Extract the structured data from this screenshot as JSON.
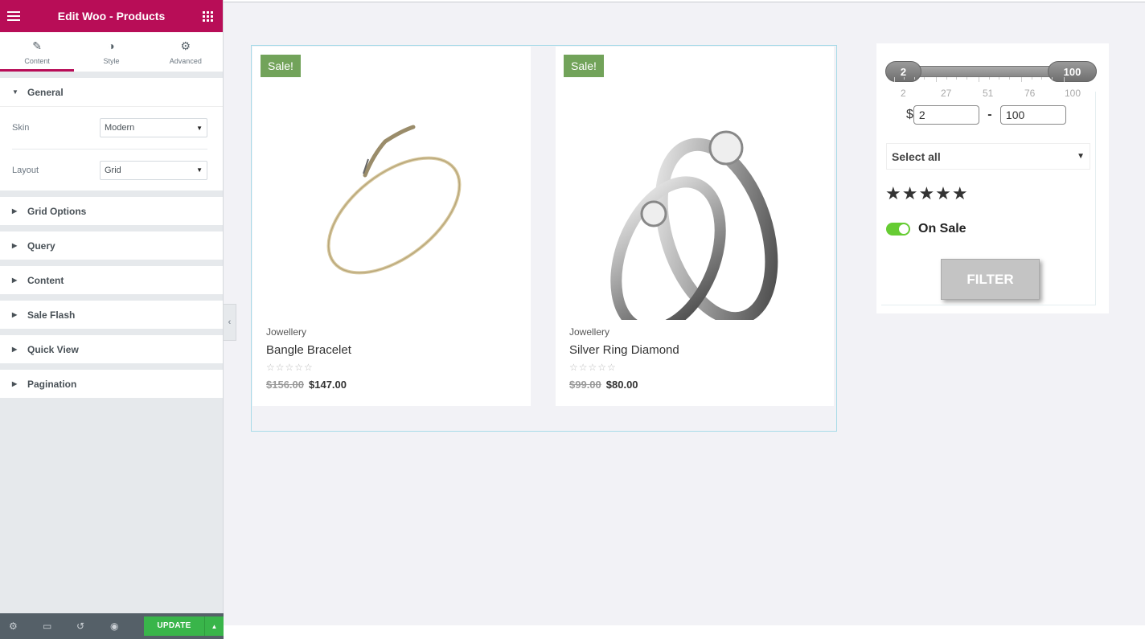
{
  "panel": {
    "title": "Edit Woo - Products",
    "tabs": [
      {
        "label": "Content",
        "icon": "pencil-icon"
      },
      {
        "label": "Style",
        "icon": "half-circle-icon"
      },
      {
        "label": "Advanced",
        "icon": "gear-icon"
      }
    ],
    "general": {
      "heading": "General",
      "skin_label": "Skin",
      "skin_value": "Modern",
      "layout_label": "Layout",
      "layout_value": "Grid"
    },
    "sections": [
      "Grid Options",
      "Query",
      "Content",
      "Sale Flash",
      "Quick View",
      "Pagination"
    ],
    "footer": {
      "update_label": "UPDATE"
    }
  },
  "products": [
    {
      "badge": "Sale!",
      "category": "Jowellery",
      "name": "Bangle Bracelet",
      "old_price": "$156.00",
      "price": "$147.00",
      "image": "gold-bracelet"
    },
    {
      "badge": "Sale!",
      "category": "Jowellery",
      "name": "Silver Ring Diamond",
      "old_price": "$99.00",
      "price": "$80.00",
      "image": "silver-rings"
    }
  ],
  "filter": {
    "slider_min": "2",
    "slider_max": "100",
    "ticks": [
      "2",
      "27",
      "51",
      "76",
      "100"
    ],
    "currency": "$",
    "min_value": "2",
    "max_value": "100",
    "dash": "-",
    "category_select": "Select all",
    "rating": "★★★★★",
    "on_sale_label": "On Sale",
    "on_sale_enabled": true,
    "filter_button": "FILTER"
  },
  "colors": {
    "brand": "#b80d57",
    "sale_badge": "#72a35a",
    "update_button": "#39b54a",
    "toggle_on": "#66cc33"
  }
}
